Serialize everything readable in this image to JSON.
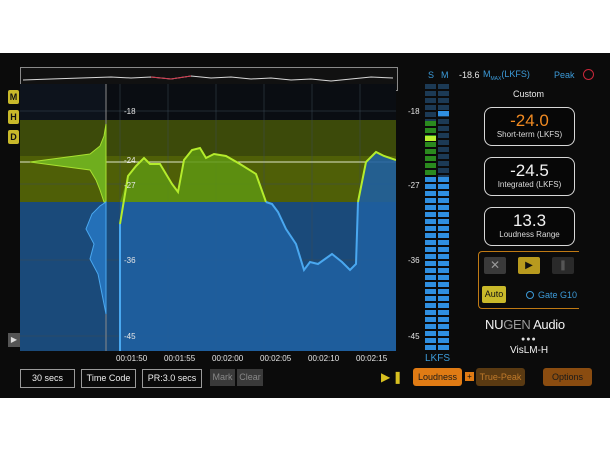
{
  "overview_label": "",
  "side_buttons": [
    "M",
    "H",
    "D"
  ],
  "main_scale": [
    "-18",
    "-24",
    "-27",
    "-36",
    "-45"
  ],
  "time_ticks": [
    "00:01:50",
    "00:01:55",
    "00:02:00",
    "00:02:05",
    "00:02:10",
    "00:02:15"
  ],
  "meter": {
    "col_s": "S",
    "col_m": "M",
    "scale": [
      "-18",
      "-27",
      "-36",
      "-45"
    ],
    "unit": "LKFS"
  },
  "header": {
    "max_value": "-18.6",
    "max_label": "M",
    "max_sub": "MAX",
    "max_unit": "(LKFS)",
    "peak_label": "Peak"
  },
  "preset": "Custom",
  "readouts": [
    {
      "value": "-24.0",
      "label": "Short-term (LKFS)",
      "color": "#f08a22"
    },
    {
      "value": "-24.5",
      "label": "Integrated (LKFS)",
      "color": "#f2f2f2"
    },
    {
      "value": "13.3",
      "label": "Loudness Range",
      "color": "#f2f2f2"
    }
  ],
  "transport": {
    "stop_icon": "x-icon",
    "play_icon": "play-icon",
    "pause_icon": "pause-icon",
    "auto_label": "Auto",
    "gate_label": "Gate G10"
  },
  "brand": {
    "nu": "NU",
    "gen": "GEN",
    "audio": " Audio",
    "product": "VisLM-H"
  },
  "bottom": {
    "window": "30 secs",
    "timecode": "Time Code",
    "pr": "PR:3.0 secs",
    "mark": "Mark",
    "clear": "Clear",
    "loudness": "Loudness",
    "plus": "+",
    "true_peak": "True-Peak",
    "options": "Options"
  },
  "colors": {
    "accent": "#e07b14",
    "green": "#9cdc2a",
    "blue": "#2f8fe0",
    "target_band": "#4a5a06",
    "button_yellow": "#c9b92a"
  }
}
